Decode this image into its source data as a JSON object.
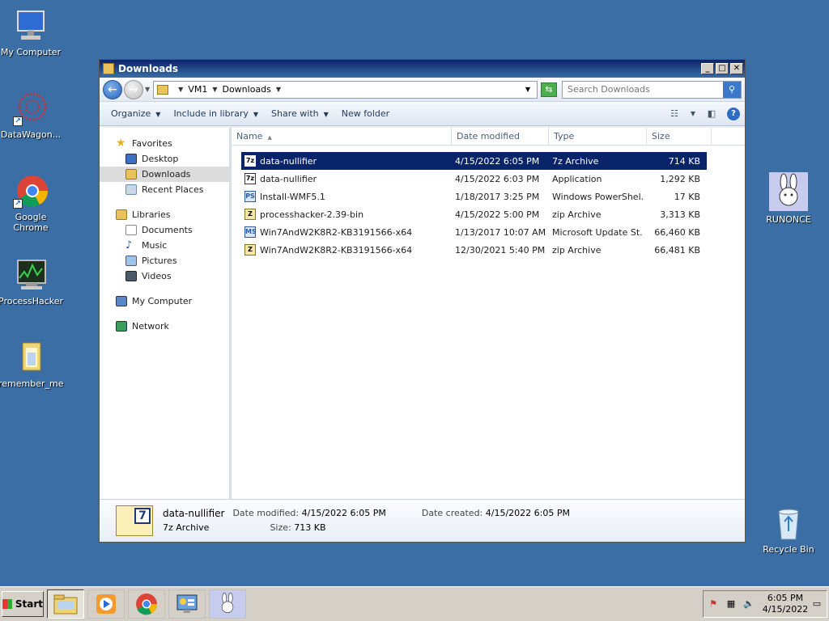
{
  "desktop": {
    "icons": [
      {
        "label": "My Computer"
      },
      {
        "label": "DataWagon..."
      },
      {
        "label": "Google Chrome"
      },
      {
        "label": "ProcessHacker"
      },
      {
        "label": "remember_me"
      },
      {
        "label": "RUNONCE"
      },
      {
        "label": "Recycle Bin"
      }
    ]
  },
  "window": {
    "title": "Downloads",
    "address": {
      "crumbs": [
        "VM1",
        "Downloads"
      ]
    },
    "search": {
      "placeholder": "Search Downloads"
    },
    "commands": {
      "organize": "Organize",
      "include": "Include in library",
      "share": "Share with",
      "new_folder": "New folder"
    },
    "nav": {
      "favorites": "Favorites",
      "desktop": "Desktop",
      "downloads": "Downloads",
      "recent": "Recent Places",
      "libraries": "Libraries",
      "documents": "Documents",
      "music": "Music",
      "pictures": "Pictures",
      "videos": "Videos",
      "my_computer": "My Computer",
      "network": "Network"
    },
    "columns": {
      "name": "Name",
      "date": "Date modified",
      "type": "Type",
      "size": "Size"
    },
    "files": [
      {
        "icon": "7z",
        "name": "data-nullifier",
        "date": "4/15/2022 6:05 PM",
        "type": "7z Archive",
        "size": "714 KB"
      },
      {
        "icon": "7z",
        "name": "data-nullifier",
        "date": "4/15/2022 6:03 PM",
        "type": "Application",
        "size": "1,292 KB"
      },
      {
        "icon": "PS",
        "name": "Install-WMF5.1",
        "date": "1/18/2017 3:25 PM",
        "type": "Windows PowerShel...",
        "size": "17 KB"
      },
      {
        "icon": "Z",
        "name": "processhacker-2.39-bin",
        "date": "4/15/2022 5:00 PM",
        "type": "zip Archive",
        "size": "3,313 KB"
      },
      {
        "icon": "MS",
        "name": "Win7AndW2K8R2-KB3191566-x64",
        "date": "1/13/2017 10:07 AM",
        "type": "Microsoft Update St...",
        "size": "66,460 KB"
      },
      {
        "icon": "Z",
        "name": "Win7AndW2K8R2-KB3191566-x64",
        "date": "12/30/2021 5:40 PM",
        "type": "zip Archive",
        "size": "66,481 KB"
      }
    ],
    "details": {
      "name": "data-nullifier",
      "type": "7z Archive",
      "modified_label": "Date modified:",
      "modified_value": "4/15/2022 6:05 PM",
      "size_label": "Size:",
      "size_value": "713 KB",
      "created_label": "Date created:",
      "created_value": "4/15/2022 6:05 PM"
    }
  },
  "taskbar": {
    "start": "Start",
    "clock_time": "6:05 PM",
    "clock_date": "4/15/2022"
  }
}
